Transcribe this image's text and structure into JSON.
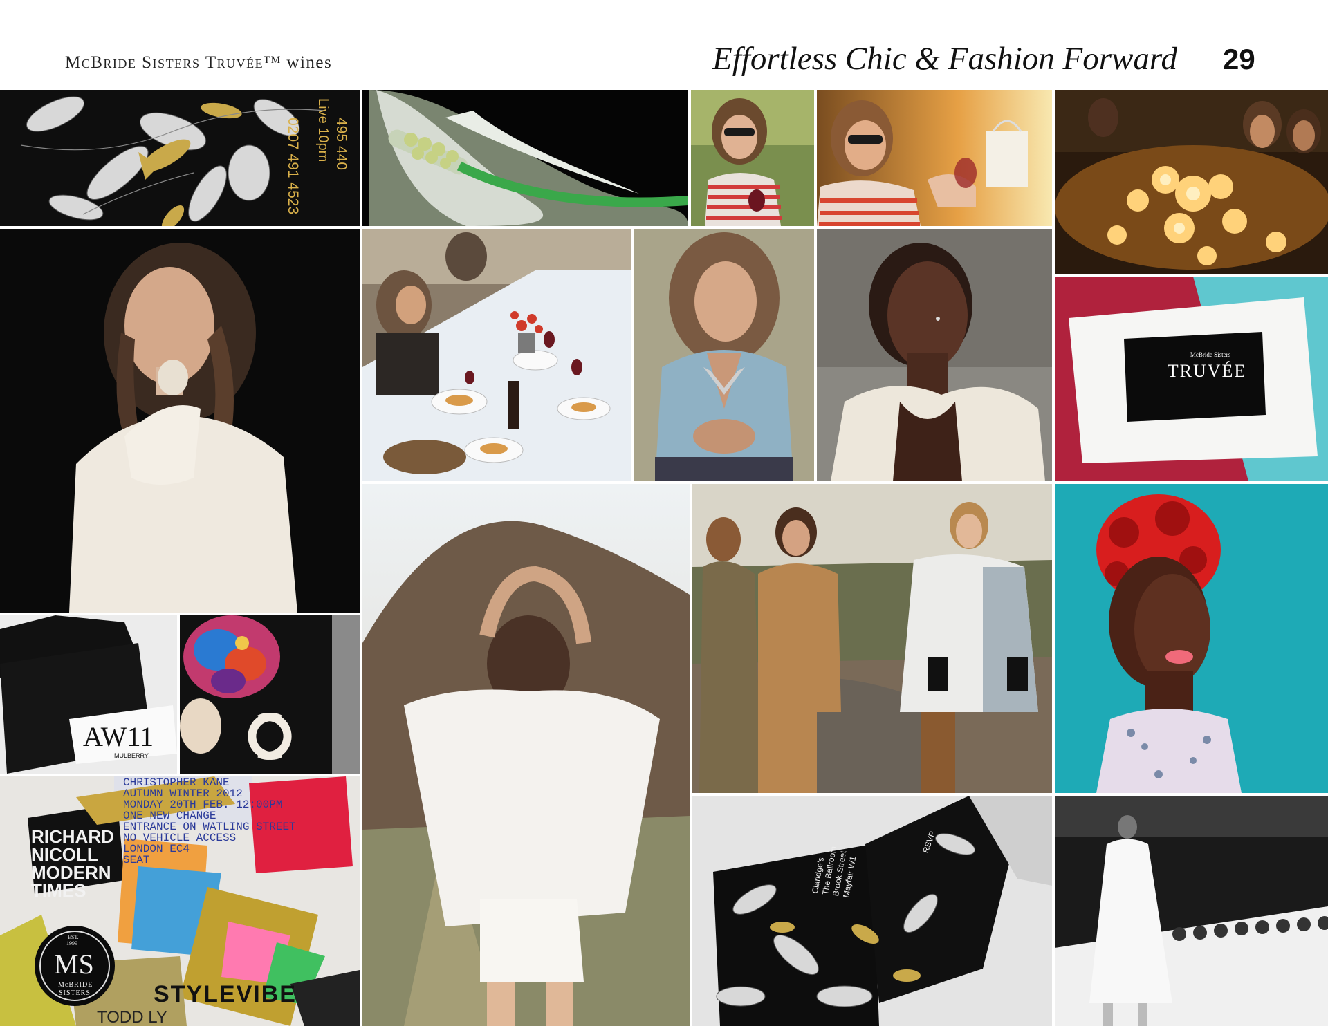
{
  "header": {
    "brand_prefix": "McBride Sisters Truvée",
    "brand_tm": "TM",
    "brand_suffix": "wines",
    "section_title": "Effortless Chic & Fashion Forward",
    "page_number": "29"
  },
  "tiles": {
    "floral_invite": {
      "text": "Live  10pm",
      "phone1": "0207 491 4523",
      "phone2": "495 440"
    },
    "truvee_card": {
      "brand": "McBride Sisters",
      "name": "TRUVÉE"
    },
    "aw11": {
      "label": "AW11",
      "maker": "MULBERRY"
    },
    "collage": {
      "poster_lines": [
        "CHRISTOPHER KANE",
        "AUTUMN WINTER 2012",
        "MONDAY 20TH FEB. 12:00PM",
        "ONE NEW CHANGE",
        "ENTRANCE ON WATLING STREET",
        "NO VEHICLE ACCESS",
        "LONDON EC4",
        "SEAT"
      ],
      "card_lines": [
        "RICHARD",
        "NICOLL",
        "MODERN",
        "TIMES"
      ],
      "card_todd": "TODD LY",
      "seal_line1": "EST.",
      "seal_line2": "1999",
      "seal_initials": "MS",
      "seal_name1": "McBRIDE",
      "seal_name2": "SISTERS",
      "stylevibe": "STYLEVIBE"
    },
    "claridges": {
      "line1": "Claridge's",
      "line2": "The Ballroom",
      "line3": "Brook Street",
      "line4": "Mayfair W1",
      "rsvp": "RSVP"
    }
  }
}
